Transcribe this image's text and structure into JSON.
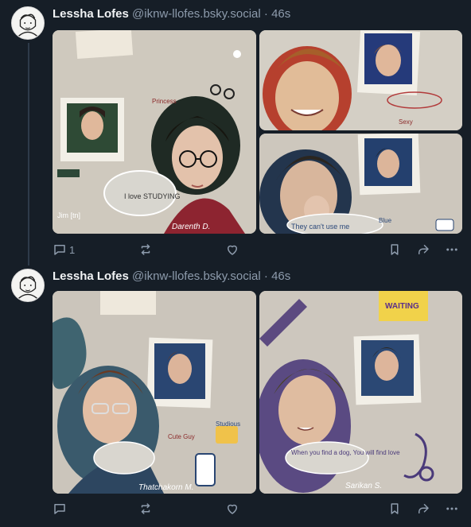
{
  "posts": [
    {
      "author": {
        "display_name": "Lessha Lofes",
        "handle": "@iknw-llofes.bsky.social"
      },
      "separator": "·",
      "time": "46s",
      "images": [
        {
          "alt": "Illustration collage of a young man with glasses",
          "texts": [
            "Princess",
            "Darenth D.",
            "I love STUDYING",
            "Jim [tn]"
          ]
        },
        {
          "alt": "Illustration of a smiling young man with light brown hair",
          "texts": [
            "Sexy"
          ]
        },
        {
          "alt": "Illustration of a young man with dark hair covering his mouth",
          "texts": [
            "They can't use me",
            "Blue"
          ]
        }
      ],
      "actions": {
        "reply_count": "1"
      }
    },
    {
      "author": {
        "display_name": "Lessha Lofes",
        "handle": "@iknw-llofes.bsky.social"
      },
      "separator": "·",
      "time": "46s",
      "images": [
        {
          "alt": "Illustration collage of a young man with glasses in a blue shirt",
          "texts": [
            "Thatchakorn M.",
            "Studious",
            "Cute Guy"
          ]
        },
        {
          "alt": "Illustration collage of a smiling young man with long hair",
          "texts": [
            "WAITING",
            "Sarikan S.",
            "When you find a dog, You will find love"
          ]
        }
      ],
      "actions": {
        "reply_count": ""
      }
    }
  ],
  "colors": {
    "background": "#161e27",
    "text_primary": "#f1f3f5",
    "text_secondary": "#8d9bac",
    "thread_line": "#2e3b4a"
  },
  "icons": [
    "reply-icon",
    "repost-icon",
    "like-icon",
    "bookmark-icon",
    "share-icon",
    "more-icon"
  ]
}
